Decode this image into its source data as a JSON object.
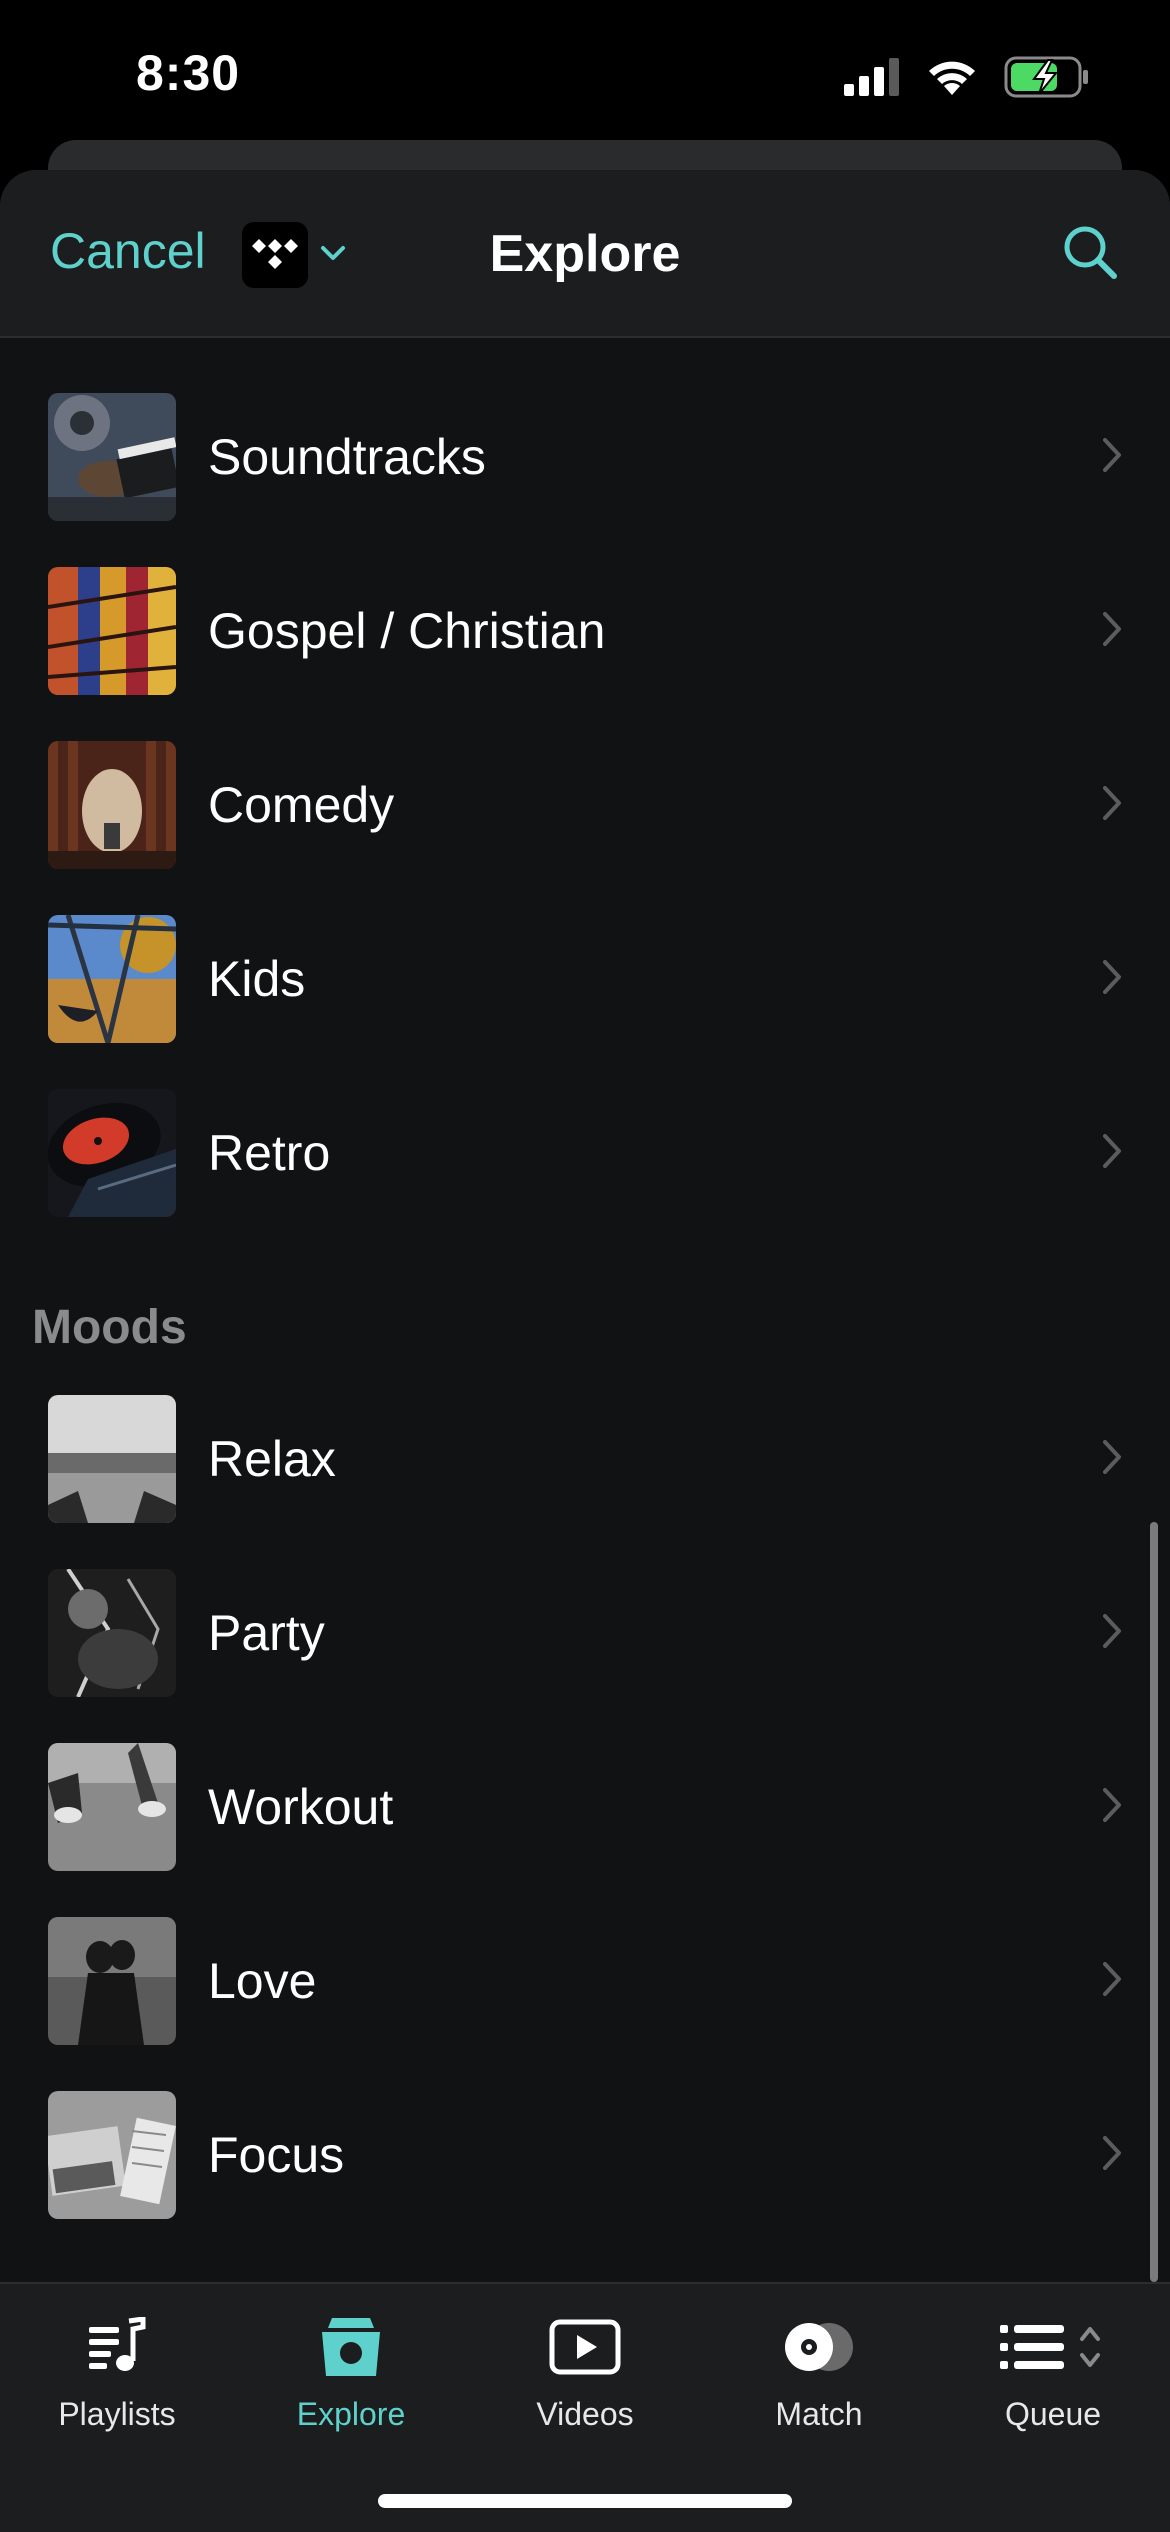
{
  "status_bar": {
    "time": "8:30"
  },
  "nav": {
    "cancel_label": "Cancel",
    "title": "Explore",
    "service_icon": "tidal-logo-icon",
    "dropdown_icon": "chevron-down-icon",
    "search_icon": "search-icon"
  },
  "genres": [
    {
      "label": "Soundtracks",
      "thumb": "soundtracks-thumbnail"
    },
    {
      "label": "Gospel / Christian",
      "thumb": "gospel-thumbnail"
    },
    {
      "label": "Comedy",
      "thumb": "comedy-thumbnail"
    },
    {
      "label": "Kids",
      "thumb": "kids-thumbnail"
    },
    {
      "label": "Retro",
      "thumb": "retro-thumbnail"
    }
  ],
  "moods_header": "Moods",
  "moods": [
    {
      "label": "Relax",
      "thumb": "relax-thumbnail"
    },
    {
      "label": "Party",
      "thumb": "party-thumbnail"
    },
    {
      "label": "Workout",
      "thumb": "workout-thumbnail"
    },
    {
      "label": "Love",
      "thumb": "love-thumbnail"
    },
    {
      "label": "Focus",
      "thumb": "focus-thumbnail"
    }
  ],
  "tabs": [
    {
      "label": "Playlists",
      "icon": "playlists-icon",
      "active": false
    },
    {
      "label": "Explore",
      "icon": "explore-icon",
      "active": true
    },
    {
      "label": "Videos",
      "icon": "videos-icon",
      "active": false
    },
    {
      "label": "Match",
      "icon": "match-icon",
      "active": false
    },
    {
      "label": "Queue",
      "icon": "queue-icon",
      "active": false
    }
  ],
  "colors": {
    "accent": "#5fd1cc",
    "background": "#111213",
    "nav_background": "#1c1d1e",
    "section_header": "#8a8b8d"
  }
}
